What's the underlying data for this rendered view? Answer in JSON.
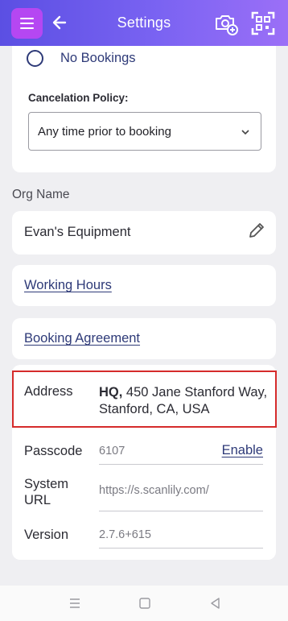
{
  "header": {
    "title": "Settings",
    "menu_icon": "hamburger-menu-icon",
    "back_icon": "arrow-left-icon",
    "action_icons": [
      "camera-add-icon",
      "qr-scan-icon"
    ],
    "accent_color": "#b547f2"
  },
  "booking": {
    "radio_option_label": "No Bookings",
    "cancelation_label": "Cancelation Policy:",
    "cancelation_value": "Any time prior to booking"
  },
  "org": {
    "section_label": "Org Name",
    "name": "Evan's Equipment"
  },
  "links": {
    "working_hours": "Working Hours",
    "booking_agreement": "Booking Agreement"
  },
  "info": {
    "address_label": "Address",
    "address_prefix": "HQ,",
    "address_text": " 450 Jane Stanford Way, Stanford, CA, USA",
    "passcode_label": "Passcode",
    "passcode_value": "6107",
    "passcode_action": "Enable",
    "system_url_label": "System URL",
    "system_url_value": "https://s.scanlily.com/",
    "version_label": "Version",
    "version_value": "2.7.6+615"
  },
  "navbar": {
    "icons": [
      "recent-apps-icon",
      "home-icon",
      "back-triangle-icon"
    ]
  },
  "highlight_color": "#d52b2b"
}
